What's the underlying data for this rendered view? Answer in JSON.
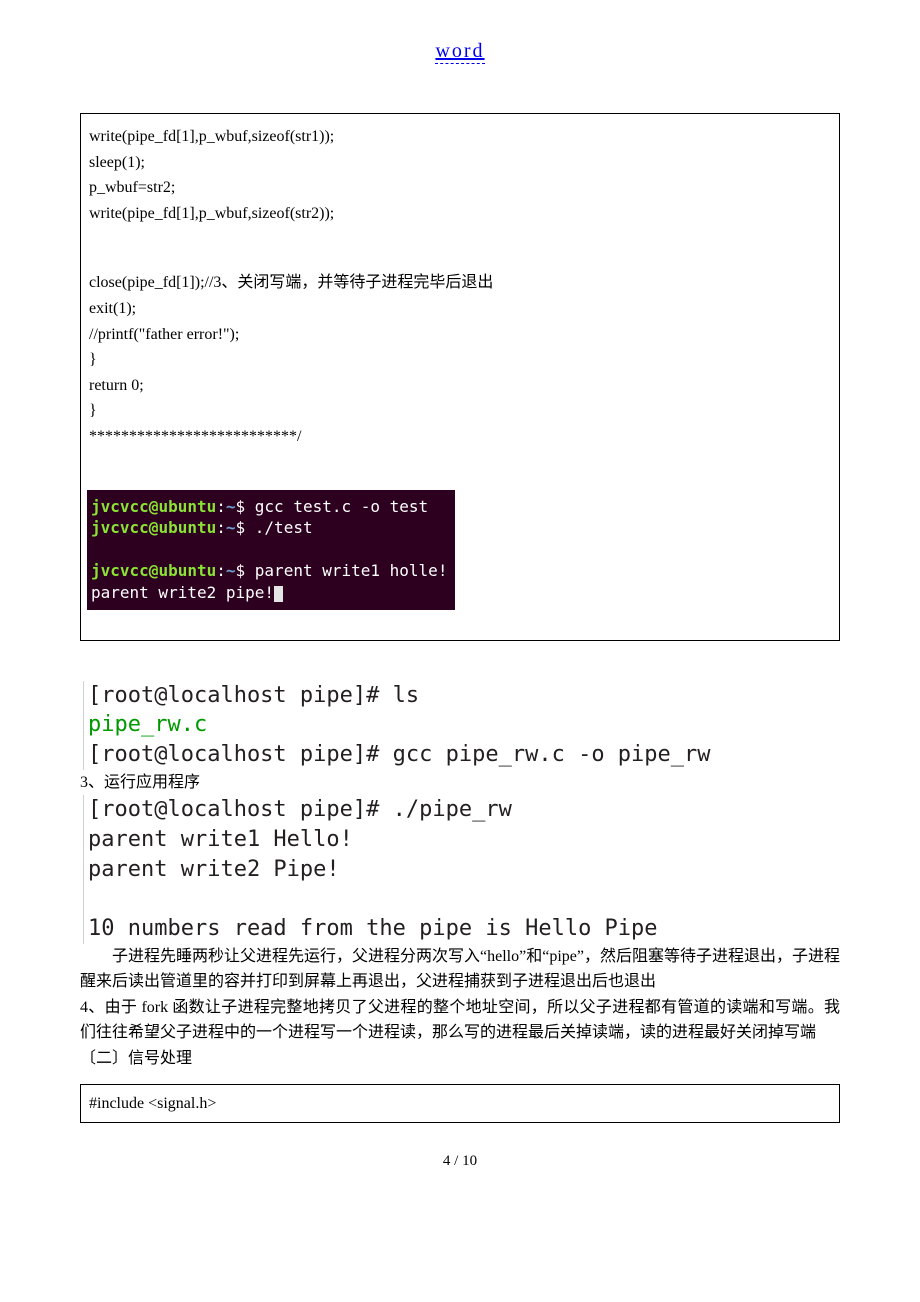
{
  "header": {
    "link": "word"
  },
  "codebox1": {
    "l1": "write(pipe_fd[1],p_wbuf,sizeof(str1));",
    "l2": "sleep(1);",
    "l3": "p_wbuf=str2;",
    "l4": "write(pipe_fd[1],p_wbuf,sizeof(str2));",
    "l5": "",
    "l6": "close(pipe_fd[1]);//3、关闭写端，并等待子进程完毕后退出",
    "l7": "exit(1);",
    "l8": "//printf(\"father error!\");",
    "l9": "}",
    "l10": "return 0;",
    "l11": "}",
    "l12": "**************************/"
  },
  "term": {
    "user": "jvcvcc",
    "at": "@",
    "host": "ubuntu",
    "path": "~",
    "dollar": "$",
    "cmd1": " gcc test.c -o test",
    "cmd2": " ./test",
    "cmd3": " parent write1 holle!",
    "out1": "parent write2 pipe!"
  },
  "mono": {
    "l1": "[root@localhost pipe]# ls",
    "l2": "pipe_rw.c",
    "l3": "[root@localhost pipe]# gcc pipe_rw.c -o pipe_rw",
    "l4": "[root@localhost pipe]# ./pipe_rw",
    "l5": "parent write1 Hello!",
    "l6": "parent write2 Pipe!",
    "l7": "10 numbers read from the pipe is Hello Pipe"
  },
  "section3_label": "3、运行应用程序",
  "para1": "子进程先睡两秒让父进程先运行，父进程分两次写入“hello”和“pipe”，然后阻塞等待子进程退出，子进程醒来后读出管道里的容并打印到屏幕上再退出，父进程捕获到子进程退出后也退出",
  "para2": "4、由于 fork 函数让子进程完整地拷贝了父进程的整个地址空间，所以父子进程都有管道的读端和写端。我们往往希望父子进程中的一个进程写一个进程读，那么写的进程最后关掉读端，读的进程最好关闭掉写端",
  "para3": "〔二〕信号处理",
  "codebox2": {
    "l1": "#include <signal.h>"
  },
  "footer": {
    "page": "4 / 10"
  }
}
